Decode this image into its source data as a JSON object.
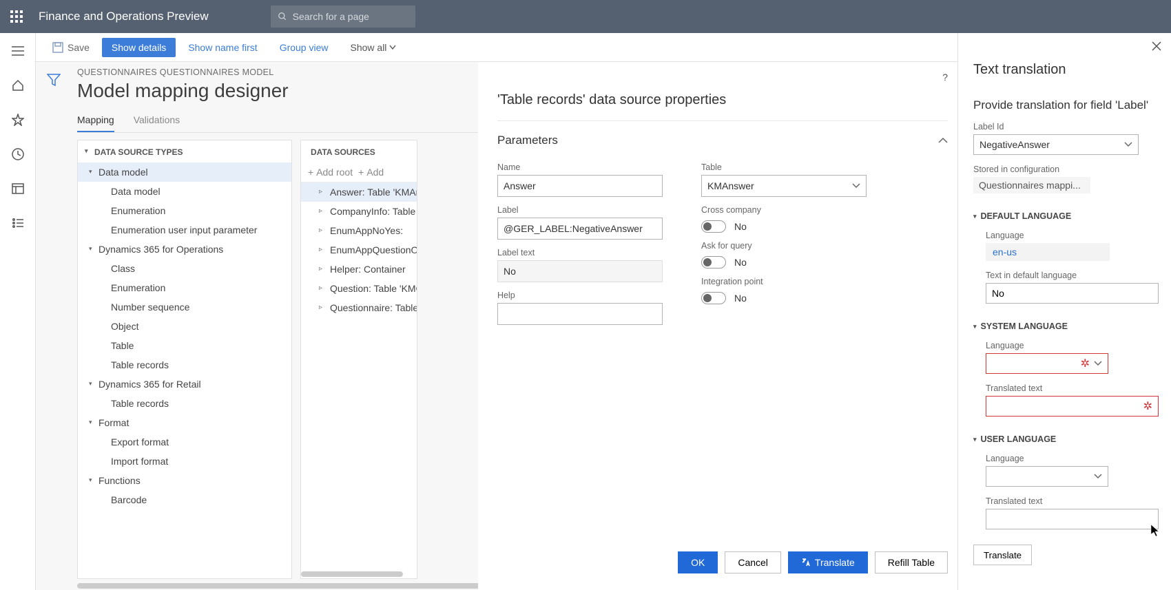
{
  "header": {
    "app_title": "Finance and Operations Preview",
    "search_placeholder": "Search for a page"
  },
  "toolbar": {
    "save": "Save",
    "show_details": "Show details",
    "show_name_first": "Show name first",
    "group_view": "Group view",
    "show_all": "Show all"
  },
  "breadcrumb": "QUESTIONNAIRES QUESTIONNAIRES MODEL",
  "page_title": "Model mapping designer",
  "tabs": {
    "mapping": "Mapping",
    "validations": "Validations"
  },
  "ds_types": {
    "title": "DATA SOURCE TYPES",
    "nodes": [
      {
        "label": "Data model",
        "group": true,
        "selected": true,
        "children": [
          "Data model",
          "Enumeration",
          "Enumeration user input parameter"
        ]
      },
      {
        "label": "Dynamics 365 for Operations",
        "group": true,
        "children": [
          "Class",
          "Enumeration",
          "Number sequence",
          "Object",
          "Table",
          "Table records"
        ]
      },
      {
        "label": "Dynamics 365 for Retail",
        "group": true,
        "children": [
          "Table records"
        ]
      },
      {
        "label": "Format",
        "group": true,
        "children": [
          "Export format",
          "Import format"
        ]
      },
      {
        "label": "Functions",
        "group": true,
        "children": [
          "Barcode"
        ]
      }
    ]
  },
  "ds": {
    "title": "DATA SOURCES",
    "add_root": "Add root",
    "add": "Add",
    "items": [
      {
        "label": "Answer: Table 'KMAnswer'",
        "selected": true
      },
      {
        "label": "CompanyInfo: Table"
      },
      {
        "label": "EnumAppNoYes:"
      },
      {
        "label": "EnumAppQuestionOrder"
      },
      {
        "label": "Helper: Container"
      },
      {
        "label": "Question: Table 'KMQuestion'"
      },
      {
        "label": "Questionnaire: Table"
      }
    ]
  },
  "prop": {
    "title": "'Table records' data source properties",
    "parameters": "Parameters",
    "name_lbl": "Name",
    "name_val": "Answer",
    "label_lbl": "Label",
    "label_val": "@GER_LABEL:NegativeAnswer",
    "label_text_lbl": "Label text",
    "label_text_val": "No",
    "help_lbl": "Help",
    "help_val": "",
    "table_lbl": "Table",
    "table_val": "KMAnswer",
    "cross_lbl": "Cross company",
    "cross_val": "No",
    "ask_lbl": "Ask for query",
    "ask_val": "No",
    "int_lbl": "Integration point",
    "int_val": "No",
    "ok": "OK",
    "cancel": "Cancel",
    "translate": "Translate",
    "refill": "Refill Table"
  },
  "rp": {
    "title": "Text translation",
    "sub": "Provide translation for field 'Label'",
    "label_id_lbl": "Label Id",
    "label_id_val": "NegativeAnswer",
    "stored_lbl": "Stored in configuration",
    "stored_val": "Questionnaires mappi...",
    "default_lang_section": "DEFAULT LANGUAGE",
    "lang_lbl": "Language",
    "lang_val": "en-us",
    "text_def_lbl": "Text in default language",
    "text_def_val": "No",
    "sys_lang_section": "SYSTEM LANGUAGE",
    "sys_lang_val": "",
    "trans_text_lbl": "Translated text",
    "trans_text_val": "",
    "user_lang_section": "USER LANGUAGE",
    "user_lang_val": "",
    "user_trans_val": "",
    "translate_btn": "Translate"
  }
}
